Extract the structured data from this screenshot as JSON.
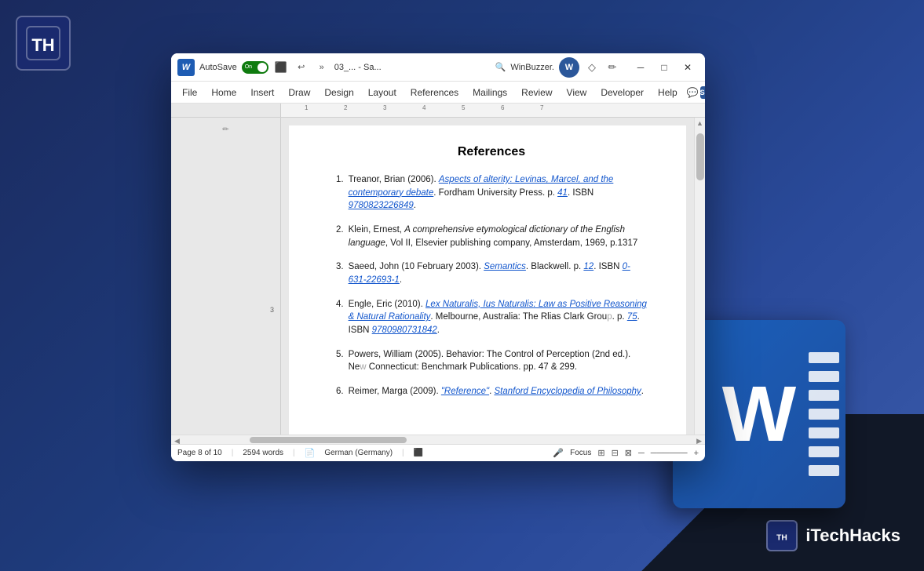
{
  "background": {
    "color_start": "#1a2a5e",
    "color_end": "#3a5aaa"
  },
  "brand": {
    "name": "iTechHacks",
    "logo_text": "TH"
  },
  "word_window": {
    "title_bar": {
      "logo_text": "W",
      "autosave_label": "AutoSave",
      "toggle_state": "On",
      "filename": "03_... - Sa...",
      "app_name": "WinBuzzer.",
      "search_placeholder": "Search",
      "minimize_label": "─",
      "maximize_label": "□",
      "close_label": "✕"
    },
    "menu_bar": {
      "items": [
        "File",
        "Home",
        "Insert",
        "Draw",
        "Design",
        "Layout",
        "References",
        "Mailings",
        "Review",
        "View",
        "Developer",
        "Help"
      ]
    },
    "document": {
      "heading": "References",
      "references": [
        {
          "number": "1.",
          "text_before": "Treanor, Brian (2006).",
          "link": "Aspects of alterity: Levinas, Marcel, and the contemporary debate",
          "text_after": ". Fordham University Press. p. 41. ISBN 9780823226849."
        },
        {
          "number": "2.",
          "text_plain": "Klein, Ernest, A comprehensive etymological dictionary of the English language, Vol II, Elsevier publishing company, Amsterdam, 1969, p.1317"
        },
        {
          "number": "3.",
          "text_before": "Saeed, John (10 February 2003).",
          "link_semantics": "Semantics",
          "text_after": ". Blackwell. p. 12. ISBN 0-631-22693-1."
        },
        {
          "number": "4.",
          "text_before": "Engle, Eric (2010).",
          "link": "Lex Naturalis, Ius Naturalis: Law as Positive Reasoning & Natural Rationality",
          "text_after": ". Melbourne, Australia: The Rlias Clark Group. p. 75. ISBN 9780980731842."
        },
        {
          "number": "5.",
          "text_plain": "Powers, William (2005). Behavior: The Control of Perception (2nd ed.). New Connecticut: Benchmark Publications. pp. 47 & 299."
        },
        {
          "number": "6.",
          "text_before": "Reimer, Marga (2009).",
          "link": "\"Reference\"",
          "text_after": ". Stanford Encyclopedia of Philosophy."
        }
      ]
    },
    "status_bar": {
      "page": "Page 8 of 10",
      "words": "2594 words",
      "language": "German (Germany)",
      "focus": "Focus"
    }
  }
}
